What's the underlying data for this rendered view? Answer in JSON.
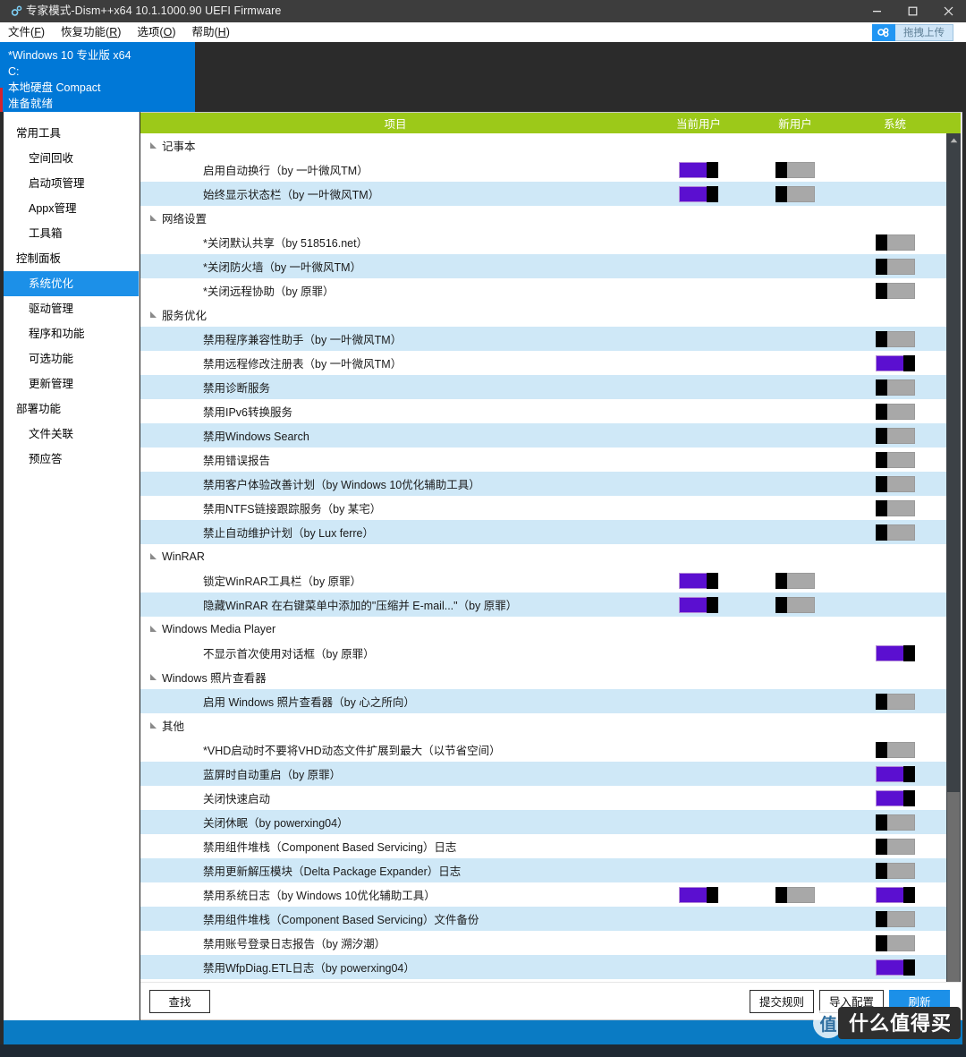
{
  "window": {
    "title": "专家模式-Dism++x64 10.1.1000.90 UEFI Firmware",
    "app_icon": "gears-icon",
    "minimize_label": "–",
    "maximize_label": "❐",
    "close_label": "✕"
  },
  "menu": {
    "items": [
      {
        "label": "文件",
        "mnemonic": "F"
      },
      {
        "label": "恢复功能",
        "mnemonic": "R"
      },
      {
        "label": "选项",
        "mnemonic": "O"
      },
      {
        "label": "帮助",
        "mnemonic": "H"
      }
    ],
    "upload_button": {
      "label": "拖拽上传",
      "icon": "cloud-upload-icon"
    }
  },
  "info_panel": {
    "lines": [
      "*Windows 10 专业版 x64",
      "C:",
      "本地硬盘 Compact",
      "准备就绪"
    ],
    "background": "#0078d7"
  },
  "sidebar": {
    "sections": [
      {
        "title": "常用工具",
        "items": [
          {
            "label": "空间回收",
            "active": false
          },
          {
            "label": "启动项管理",
            "active": false
          },
          {
            "label": "Appx管理",
            "active": false
          },
          {
            "label": "工具箱",
            "active": false
          }
        ]
      },
      {
        "title": "控制面板",
        "items": [
          {
            "label": "系统优化",
            "active": true
          },
          {
            "label": "驱动管理",
            "active": false
          },
          {
            "label": "程序和功能",
            "active": false
          },
          {
            "label": "可选功能",
            "active": false
          },
          {
            "label": "更新管理",
            "active": false
          }
        ]
      },
      {
        "title": "部署功能",
        "items": [
          {
            "label": "文件关联",
            "active": false
          },
          {
            "label": "预应答",
            "active": false
          }
        ]
      }
    ],
    "active_accent": "#1c90e8"
  },
  "table": {
    "header_color": "#9cc919",
    "columns": [
      "项目",
      "当前用户",
      "新用户",
      "系统"
    ],
    "groups": [
      {
        "name": "记事本",
        "expanded": true,
        "rows": [
          {
            "label": "启用自动换行（by 一叶微风TM）",
            "current_user": "on",
            "new_user": "off",
            "system": null
          },
          {
            "label": "始终显示状态栏（by 一叶微风TM）",
            "current_user": "on",
            "new_user": "off",
            "system": null
          }
        ]
      },
      {
        "name": "网络设置",
        "expanded": true,
        "rows": [
          {
            "label": "*关闭默认共享（by 518516.net）",
            "current_user": null,
            "new_user": null,
            "system": "off"
          },
          {
            "label": "*关闭防火墙（by 一叶微风TM）",
            "current_user": null,
            "new_user": null,
            "system": "off"
          },
          {
            "label": "*关闭远程协助（by 原罪）",
            "current_user": null,
            "new_user": null,
            "system": "off"
          }
        ]
      },
      {
        "name": "服务优化",
        "expanded": true,
        "rows": [
          {
            "label": "禁用程序兼容性助手（by 一叶微风TM）",
            "current_user": null,
            "new_user": null,
            "system": "off"
          },
          {
            "label": "禁用远程修改注册表（by 一叶微风TM）",
            "current_user": null,
            "new_user": null,
            "system": "on"
          },
          {
            "label": "禁用诊断服务",
            "current_user": null,
            "new_user": null,
            "system": "off"
          },
          {
            "label": "禁用IPv6转换服务",
            "current_user": null,
            "new_user": null,
            "system": "off"
          },
          {
            "label": "禁用Windows Search",
            "current_user": null,
            "new_user": null,
            "system": "off"
          },
          {
            "label": "禁用错误报告",
            "current_user": null,
            "new_user": null,
            "system": "off"
          },
          {
            "label": "禁用客户体验改善计划（by Windows 10优化辅助工具）",
            "current_user": null,
            "new_user": null,
            "system": "off"
          },
          {
            "label": "禁用NTFS链接跟踪服务（by 某宅）",
            "current_user": null,
            "new_user": null,
            "system": "off"
          },
          {
            "label": "禁止自动维护计划（by Lux ferre）",
            "current_user": null,
            "new_user": null,
            "system": "off"
          }
        ]
      },
      {
        "name": "WinRAR",
        "expanded": true,
        "rows": [
          {
            "label": "锁定WinRAR工具栏（by 原罪）",
            "current_user": "on",
            "new_user": "off",
            "system": null
          },
          {
            "label": "隐藏WinRAR 在右键菜单中添加的\"压缩并 E-mail...\"（by 原罪）",
            "current_user": "on",
            "new_user": "off",
            "system": null
          }
        ]
      },
      {
        "name": "Windows Media Player",
        "expanded": true,
        "rows": [
          {
            "label": "不显示首次使用对话框（by 原罪）",
            "current_user": null,
            "new_user": null,
            "system": "on"
          }
        ]
      },
      {
        "name": "Windows 照片查看器",
        "expanded": true,
        "rows": [
          {
            "label": "启用 Windows 照片查看器（by 心之所向）",
            "current_user": null,
            "new_user": null,
            "system": "off"
          }
        ]
      },
      {
        "name": "其他",
        "expanded": true,
        "rows": [
          {
            "label": "*VHD启动时不要将VHD动态文件扩展到最大（以节省空间）",
            "current_user": null,
            "new_user": null,
            "system": "off"
          },
          {
            "label": "蓝屏时自动重启（by 原罪）",
            "current_user": null,
            "new_user": null,
            "system": "on"
          },
          {
            "label": "关闭快速启动",
            "current_user": null,
            "new_user": null,
            "system": "on"
          },
          {
            "label": "关闭休眠（by powerxing04）",
            "current_user": null,
            "new_user": null,
            "system": "off"
          },
          {
            "label": "禁用组件堆栈（Component Based Servicing）日志",
            "current_user": null,
            "new_user": null,
            "system": "off"
          },
          {
            "label": "禁用更新解压模块（Delta Package Expander）日志",
            "current_user": null,
            "new_user": null,
            "system": "off"
          },
          {
            "label": "禁用系统日志（by Windows 10优化辅助工具）",
            "current_user": "on",
            "new_user": "off",
            "system": "on"
          },
          {
            "label": "禁用组件堆栈（Component Based Servicing）文件备份",
            "current_user": null,
            "new_user": null,
            "system": "off"
          },
          {
            "label": "禁用账号登录日志报告（by 溯汐潮）",
            "current_user": null,
            "new_user": null,
            "system": "off"
          },
          {
            "label": "禁用WfpDiag.ETL日志（by powerxing04）",
            "current_user": null,
            "new_user": null,
            "system": "on"
          }
        ]
      }
    ]
  },
  "footer": {
    "find_label": "查找",
    "submit_rule_label": "提交规则",
    "import_config_label": "导入配置",
    "refresh_label": "刷新",
    "primary_color": "#1c90e8"
  },
  "status_bar": {
    "text": "",
    "color": "#0a7bc4"
  },
  "watermark": {
    "badge": "值",
    "text": "什么值得买"
  }
}
